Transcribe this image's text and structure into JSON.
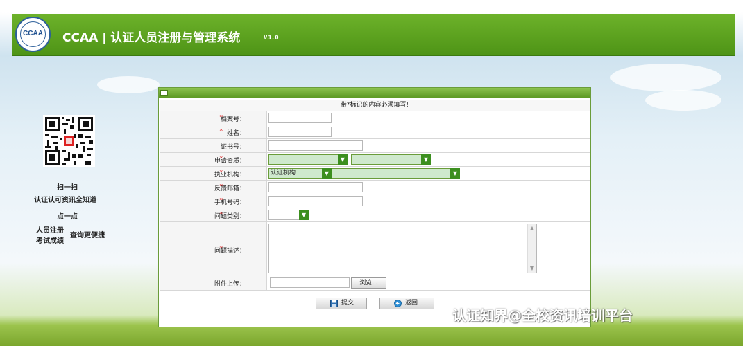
{
  "header": {
    "logo_text": "CCAA",
    "title": "CCAA | 认证人员注册与管理系统",
    "version": "V3.0"
  },
  "promo": {
    "scan": "扫一扫",
    "scan_desc": "认证认可资讯全知道",
    "tap": "点一点",
    "tap_desc_1": "人员注册",
    "tap_desc_2": "考试成绩",
    "tap_desc_3": "查询更便捷"
  },
  "form": {
    "notice": "带*标记的内容必须填写!",
    "fields": {
      "archive_no": {
        "label": "档案号：",
        "required": true,
        "value": ""
      },
      "name": {
        "label": "姓名：",
        "required": true,
        "value": ""
      },
      "cert_no": {
        "label": "证书号：",
        "required": false,
        "value": ""
      },
      "qualification": {
        "label": "申请资质：",
        "required": true,
        "value1": "",
        "value2": ""
      },
      "agency": {
        "label": "执业机构：",
        "required": true,
        "type_value": "认证机构",
        "value": ""
      },
      "email": {
        "label": "反馈邮箱：",
        "required": true,
        "value": ""
      },
      "phone": {
        "label": "手机号码：",
        "required": true,
        "value": ""
      },
      "category": {
        "label": "问题类别：",
        "required": true,
        "value": ""
      },
      "description": {
        "label": "问题描述：",
        "required": true,
        "value": ""
      },
      "attachment": {
        "label": "附件上传：",
        "required": false,
        "value": "",
        "browse_label": "浏览..."
      }
    },
    "actions": {
      "submit": "提交",
      "back": "返回"
    }
  },
  "watermark": "认证知界@全校资讯培训平台",
  "colors": {
    "brand_green": "#5a9e1e",
    "select_green": "#3c8f1f",
    "required_red": "#dd0000"
  }
}
